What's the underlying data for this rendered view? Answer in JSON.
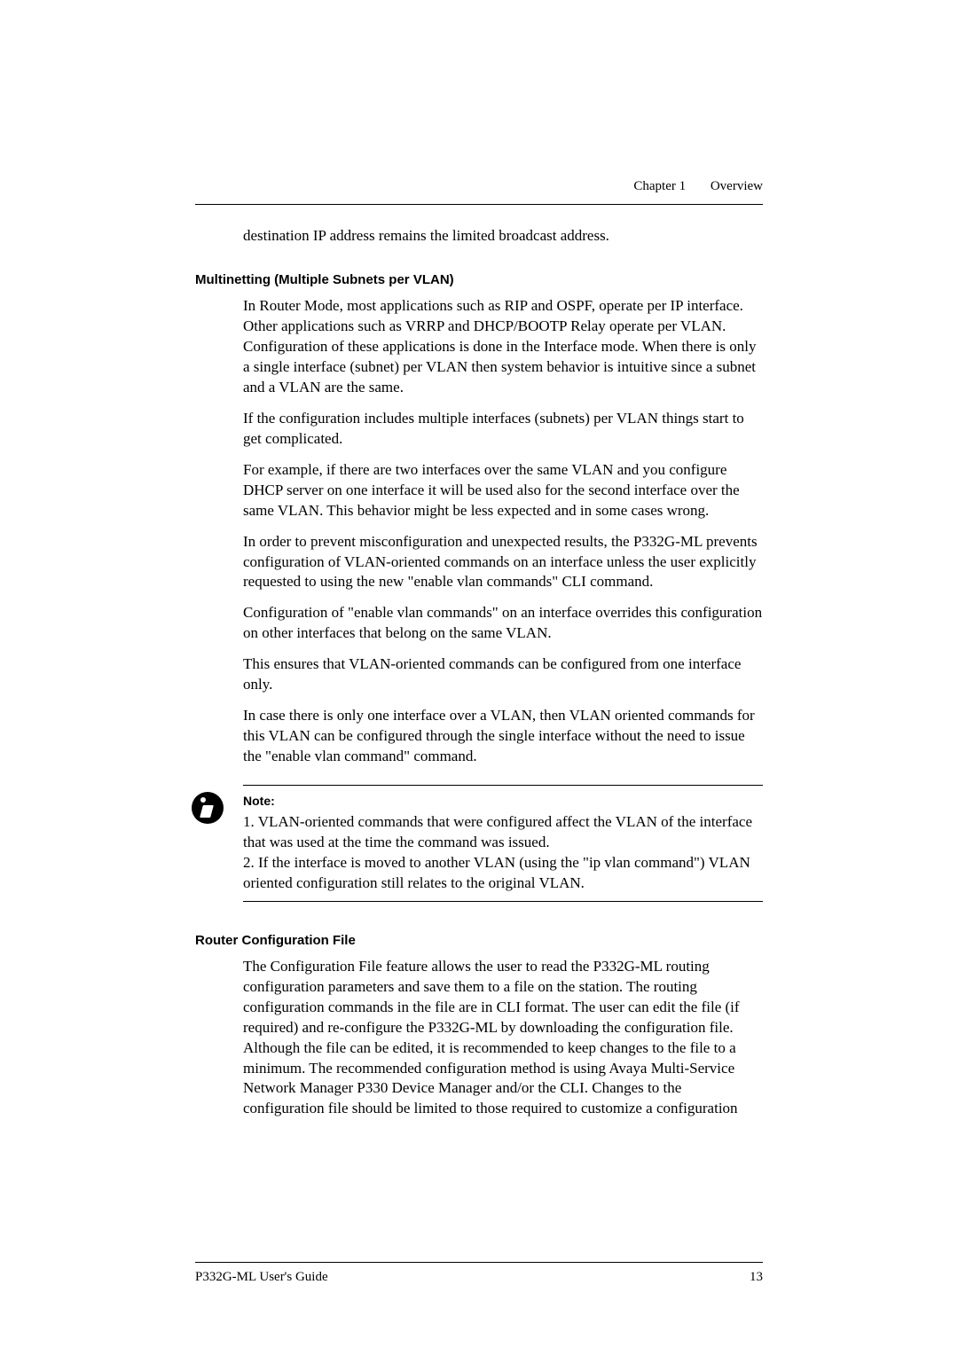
{
  "header": {
    "chapter": "Chapter 1",
    "title": "Overview"
  },
  "continuation": "destination IP address remains the limited broadcast address.",
  "section1": {
    "title": "Multinetting (Multiple Subnets per VLAN)",
    "p1": "In Router Mode, most applications such as RIP and OSPF, operate per IP interface. Other applications such as VRRP and DHCP/BOOTP Relay operate per VLAN. Configuration of these applications is done in the Interface mode. When there is only a single interface (subnet) per VLAN then system behavior is intuitive since a subnet and a VLAN are the same.",
    "p2": "If the configuration includes multiple interfaces (subnets) per VLAN things start to get complicated.",
    "p3": "For example, if there are two interfaces over the same VLAN and you configure DHCP server on one interface it will be used also for the second interface over the same VLAN. This behavior might be less expected and in some cases wrong.",
    "p4": "In order to prevent misconfiguration and unexpected results, the P332G-ML prevents configuration of VLAN-oriented commands on an interface unless the user explicitly requested to using the new \"enable vlan commands\" CLI command.",
    "p5": "Configuration of \"enable vlan commands\" on an interface overrides this configuration on other interfaces that belong on the same VLAN.",
    "p6": "This ensures that VLAN-oriented commands can be configured from one interface only.",
    "p7": "In case there is only one interface over a VLAN, then VLAN oriented commands for this VLAN can be configured through the single interface without the need to issue the \"enable vlan command\" command."
  },
  "note": {
    "label": "Note:",
    "line1": "1. VLAN-oriented commands that were configured affect the VLAN of the interface that was used at the time the command was issued.",
    "line2": "2. If the interface is moved to another VLAN (using the \"ip vlan command\") VLAN oriented configuration still relates to the original VLAN."
  },
  "section2": {
    "title": "Router Configuration File",
    "p1": "The Configuration File feature allows the user to read the P332G-ML routing configuration parameters and save them to a file on the station. The routing configuration commands in the file are in CLI format. The user can edit the file (if required) and re-configure the P332G-ML by downloading the configuration file. Although the file can be edited, it is recommended to keep changes to the file to a minimum. The recommended configuration method is using Avaya Multi-Service Network Manager P330 Device Manager and/or the CLI. Changes to the configuration file should be limited to those required to customize a configuration"
  },
  "footer": {
    "guide": "P332G-ML User's Guide",
    "pageNumber": "13"
  }
}
